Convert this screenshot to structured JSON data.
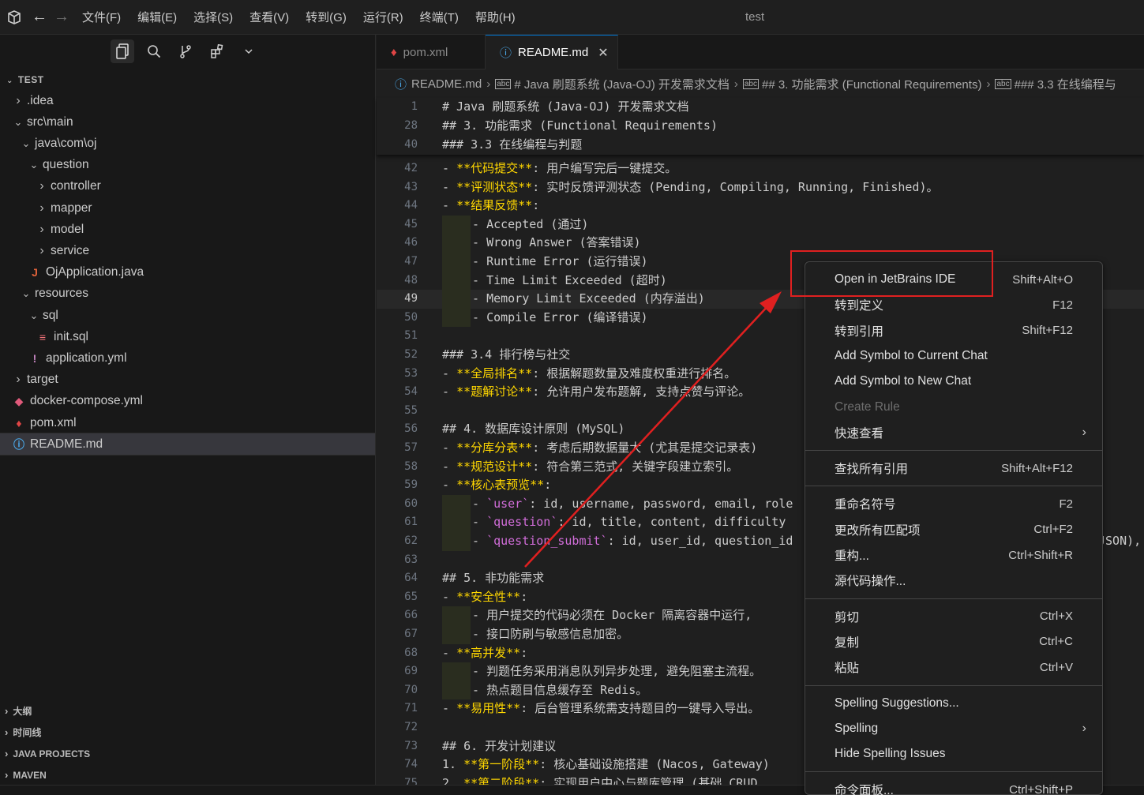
{
  "titlebar": {
    "menu": [
      "文件(F)",
      "编辑(E)",
      "选择(S)",
      "查看(V)",
      "转到(G)",
      "运行(R)",
      "终端(T)",
      "帮助(H)"
    ],
    "window_title": "test"
  },
  "sidebar": {
    "section_title": "TEST",
    "tree": [
      {
        "label": ".idea",
        "depth": 0,
        "kind": "folder",
        "expanded": false
      },
      {
        "label": "src\\main",
        "depth": 0,
        "kind": "folder",
        "expanded": true
      },
      {
        "label": "java\\com\\oj",
        "depth": 1,
        "kind": "folder",
        "expanded": true
      },
      {
        "label": "question",
        "depth": 2,
        "kind": "folder",
        "expanded": true
      },
      {
        "label": "controller",
        "depth": 3,
        "kind": "folder",
        "expanded": false
      },
      {
        "label": "mapper",
        "depth": 3,
        "kind": "folder",
        "expanded": false
      },
      {
        "label": "model",
        "depth": 3,
        "kind": "folder",
        "expanded": false
      },
      {
        "label": "service",
        "depth": 3,
        "kind": "folder",
        "expanded": false
      },
      {
        "label": "OjApplication.java",
        "depth": 2,
        "kind": "java"
      },
      {
        "label": "resources",
        "depth": 1,
        "kind": "folder",
        "expanded": true
      },
      {
        "label": "sql",
        "depth": 2,
        "kind": "folder",
        "expanded": true
      },
      {
        "label": "init.sql",
        "depth": 3,
        "kind": "sql"
      },
      {
        "label": "application.yml",
        "depth": 2,
        "kind": "yml"
      },
      {
        "label": "target",
        "depth": 0,
        "kind": "folder",
        "expanded": false
      },
      {
        "label": "docker-compose.yml",
        "depth": 0,
        "kind": "docker"
      },
      {
        "label": "pom.xml",
        "depth": 0,
        "kind": "xml"
      },
      {
        "label": "README.md",
        "depth": 0,
        "kind": "info",
        "selected": true
      }
    ],
    "bottom_sections": [
      "大纲",
      "时间线",
      "JAVA PROJECTS",
      "MAVEN"
    ]
  },
  "tabs": [
    {
      "label": "pom.xml",
      "active": false
    },
    {
      "label": "README.md",
      "active": true
    }
  ],
  "breadcrumb": [
    "README.md",
    "# Java 刷题系统 (Java-OJ) 开发需求文档",
    "## 3. 功能需求 (Functional Requirements)",
    "### 3.3 在线编程与"
  ],
  "editor": {
    "sticky": [
      {
        "n": "1",
        "text": "# Java 刷题系统 (Java-OJ) 开发需求文档"
      },
      {
        "n": "28",
        "text": "## 3. 功能需求 (Functional Requirements)"
      },
      {
        "n": "40",
        "text": "### 3.3 在线编程与判题"
      }
    ],
    "lines": [
      {
        "n": "42",
        "pre": "- ",
        "bold": "**代码提交**",
        "post": ": 用户编写完后一键提交。"
      },
      {
        "n": "43",
        "pre": "- ",
        "bold": "**评测状态**",
        "post": ": 实时反馈评测状态 (Pending, Compiling, Running, Finished)。"
      },
      {
        "n": "44",
        "pre": "- ",
        "bold": "**结果反馈**",
        "post": ":"
      },
      {
        "n": "45",
        "indent": true,
        "pre": "- ",
        "post": "Accepted (通过)"
      },
      {
        "n": "46",
        "indent": true,
        "pre": "- ",
        "post": "Wrong Answer (答案错误)"
      },
      {
        "n": "47",
        "indent": true,
        "pre": "- ",
        "post": "Runtime Error (运行错误)"
      },
      {
        "n": "48",
        "indent": true,
        "pre": "- ",
        "post": "Time Limit Exceeded (超时)"
      },
      {
        "n": "49",
        "indent": true,
        "current": true,
        "pre": "- ",
        "post": "Memory Limit Exceeded (内存溢出)"
      },
      {
        "n": "50",
        "indent": true,
        "pre": "- ",
        "post": "Compile Error (编译错误)"
      },
      {
        "n": "51",
        "post": ""
      },
      {
        "n": "52",
        "post": "### 3.4 排行榜与社交"
      },
      {
        "n": "53",
        "pre": "- ",
        "bold": "**全局排名**",
        "post": ": 根据解题数量及难度权重进行排名。"
      },
      {
        "n": "54",
        "pre": "- ",
        "bold": "**题解讨论**",
        "post": ": 允许用户发布题解, 支持点赞与评论。"
      },
      {
        "n": "55",
        "post": ""
      },
      {
        "n": "56",
        "post": "## 4. 数据库设计原则 (MySQL)"
      },
      {
        "n": "57",
        "pre": "- ",
        "bold": "**分库分表**",
        "post": ": 考虑后期数据量大 (尤其是提交记录表)"
      },
      {
        "n": "58",
        "pre": "- ",
        "bold": "**规范设计**",
        "post": ": 符合第三范式, 关键字段建立索引。"
      },
      {
        "n": "59",
        "pre": "- ",
        "bold": "**核心表预览**",
        "post": ":"
      },
      {
        "n": "60",
        "indent": true,
        "pre": "- ",
        "tick": "`user`",
        "post": ": id, username, password, email, role"
      },
      {
        "n": "61",
        "indent": true,
        "pre": "- ",
        "tick": "`question`",
        "post": ": id, title, content, difficulty"
      },
      {
        "n": "62",
        "indent": true,
        "pre": "- ",
        "tick": "`question_submit`",
        "post": ": id, user_id, question_id",
        "tail": "JSON),"
      },
      {
        "n": "63",
        "post": ""
      },
      {
        "n": "64",
        "post": "## 5. 非功能需求"
      },
      {
        "n": "65",
        "pre": "- ",
        "bold": "**安全性**",
        "post": ":"
      },
      {
        "n": "66",
        "indent": true,
        "pre": "- ",
        "post": "用户提交的代码必须在 Docker 隔离容器中运行,"
      },
      {
        "n": "67",
        "indent": true,
        "pre": "- ",
        "post": "接口防刷与敏感信息加密。"
      },
      {
        "n": "68",
        "pre": "- ",
        "bold": "**高并发**",
        "post": ":"
      },
      {
        "n": "69",
        "indent": true,
        "pre": "- ",
        "post": "判题任务采用消息队列异步处理, 避免阻塞主流程。"
      },
      {
        "n": "70",
        "indent": true,
        "pre": "- ",
        "post": "热点题目信息缓存至 Redis。"
      },
      {
        "n": "71",
        "pre": "- ",
        "bold": "**易用性**",
        "post": ": 后台管理系统需支持题目的一键导入导出。"
      },
      {
        "n": "72",
        "post": ""
      },
      {
        "n": "73",
        "post": "## 6. 开发计划建议"
      },
      {
        "n": "74",
        "pre": "1. ",
        "bold": "**第一阶段**",
        "post": ": 核心基础设施搭建 (Nacos, Gateway)"
      },
      {
        "n": "75",
        "pre": "2. ",
        "bold": "**第二阶段**",
        "post": ": 实现用户中心与题库管理 (基础 CRUD"
      }
    ]
  },
  "context_menu": [
    {
      "label": "Open in JetBrains IDE",
      "shortcut": "Shift+Alt+O"
    },
    {
      "label": "转到定义",
      "shortcut": "F12"
    },
    {
      "label": "转到引用",
      "shortcut": "Shift+F12"
    },
    {
      "label": "Add Symbol to Current Chat",
      "shortcut": ""
    },
    {
      "label": "Add Symbol to New Chat",
      "shortcut": ""
    },
    {
      "label": "Create Rule",
      "shortcut": "",
      "disabled": true
    },
    {
      "label": "快速查看",
      "shortcut": "",
      "submenu": true
    },
    {
      "sep": true
    },
    {
      "label": "查找所有引用",
      "shortcut": "Shift+Alt+F12"
    },
    {
      "sep": true
    },
    {
      "label": "重命名符号",
      "shortcut": "F2"
    },
    {
      "label": "更改所有匹配项",
      "shortcut": "Ctrl+F2"
    },
    {
      "label": "重构...",
      "shortcut": "Ctrl+Shift+R"
    },
    {
      "label": "源代码操作...",
      "shortcut": ""
    },
    {
      "sep": true
    },
    {
      "label": "剪切",
      "shortcut": "Ctrl+X"
    },
    {
      "label": "复制",
      "shortcut": "Ctrl+C"
    },
    {
      "label": "粘贴",
      "shortcut": "Ctrl+V"
    },
    {
      "sep": true
    },
    {
      "label": "Spelling Suggestions...",
      "shortcut": ""
    },
    {
      "label": "Spelling",
      "shortcut": "",
      "submenu": true
    },
    {
      "label": "Hide Spelling Issues",
      "shortcut": ""
    },
    {
      "sep": true
    },
    {
      "label": "命令面板...",
      "shortcut": "Ctrl+Shift+P"
    }
  ],
  "colors": {
    "accent": "#0078d4",
    "annotation_red": "#e02020",
    "bold_text": "#ffd700"
  }
}
